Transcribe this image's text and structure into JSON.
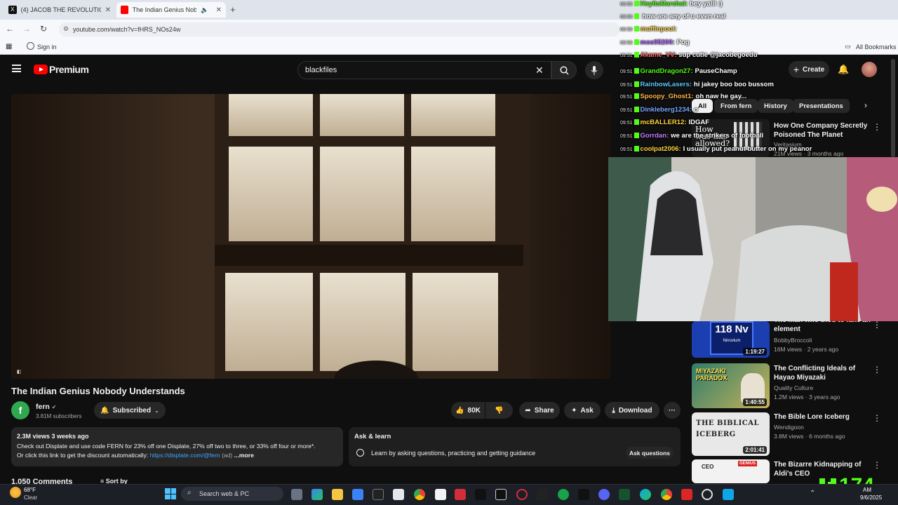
{
  "browser": {
    "tabs": [
      {
        "title": "(4) JACOB THE REVOLUTIONARY",
        "active": false
      },
      {
        "title": "The Indian Genius Nobody",
        "active": true
      }
    ],
    "url": "youtube.com/watch?v=fHRS_NOs24w",
    "sign_in": "Sign in",
    "all_bookmarks": "All Bookmarks"
  },
  "youtube": {
    "brand": "Premium",
    "search_value": "blackfiles",
    "create_label": "Create",
    "video_title": "The Indian Genius Nobody Understands",
    "channel_name": "fern",
    "subscribers": "3.81M subscribers",
    "subscribed_label": "Subscribed",
    "likes": "80K",
    "share_label": "Share",
    "ask_label": "Ask",
    "download_label": "Download",
    "description": {
      "meta": "2.3M views  3 weeks ago",
      "line1": "Check out Displate and use code FERN for 23% off one Displate, 27% off two to three, or 33% off four or more*.",
      "line2_prefix": "Or click this link to get the discount automatically:",
      "link": "https://displate.com/@fern",
      "line2_suffix": "(ad)",
      "more": "...more"
    },
    "ask_learn": {
      "title": "Ask & learn",
      "text": "Learn by asking questions, practicing and getting guidance",
      "button": "Ask questions"
    },
    "comments_partial": "1,050 Comments",
    "sort_by": "Sort by",
    "chips": [
      "All",
      "From fern",
      "History",
      "Presentations"
    ],
    "recommendations": [
      {
        "title": "How One Company Secretly Poisoned The Planet",
        "channel": "Veritasium",
        "meta": "21M views · 3 months ago",
        "thumb_text": "How was this allowed?"
      },
      {
        "title": "The man who tried to fake an element",
        "channel": "BobbyBroccoli",
        "meta": "16M views · 2 years ago",
        "duration": "1:19:27",
        "thumb_text": "118 Nv",
        "thumb_sub": "Ninovium"
      },
      {
        "title": "The Conflicting Ideals of Hayao Miyazaki",
        "channel": "Quality Culture",
        "meta": "1.2M views · 3 years ago",
        "duration": "1:40:55",
        "thumb_text": "MIYAZAKI PARADOX"
      },
      {
        "title": "The Bible Lore Iceberg",
        "channel": "Wendigoon",
        "meta": "3.8M views · 6 months ago",
        "duration": "2:01:41",
        "thumb_text": "THE BIBLICAL ICEBERG"
      },
      {
        "title": "The Bizarre Kidnapping of Aldi's CEO",
        "channel": "",
        "meta": "",
        "thumb_text": "CEO",
        "thumb_tag": "GENIUS"
      }
    ]
  },
  "chat": [
    {
      "time": "09:50",
      "user": "HeyItsMarshal:",
      "msg": "hey yalll :)",
      "color": "#53fc18"
    },
    {
      "time": "09:50",
      "user": "",
      "msg": "how are any of u even real",
      "color": "#53fc18"
    },
    {
      "time": "09:50",
      "user": "muffinpool:",
      "msg": "",
      "color": "#ffd23c"
    },
    {
      "time": "09:50",
      "user": "mos95200:",
      "msg": "Pog",
      "color": "#b36bff"
    },
    {
      "time": "09:51",
      "user": "Akame_VV:",
      "msg": "sup cutie @jacobegoedu",
      "color": "#ff6b6b"
    },
    {
      "time": "09:51",
      "user": "GrandDragon27:",
      "msg": "PauseChamp",
      "color": "#53fc18"
    },
    {
      "time": "09:51",
      "user": "RainbowLasers:",
      "msg": "hi jakey boo boo bussom",
      "color": "#5bc8ff"
    },
    {
      "time": "09:51",
      "user": "Spoopy_Ghost1:",
      "msg": "oh naw he gay...",
      "color": "#ffb347"
    },
    {
      "time": "09:51",
      "user": "Dinkleberg1234:",
      "msg": "o",
      "color": "#7aa7ff"
    },
    {
      "time": "09:51",
      "user": "mcBALLER12:",
      "msg": "IDGAF",
      "color": "#ffd23c"
    },
    {
      "time": "09:51",
      "user": "Gorrdan:",
      "msg": "we are the strikers of football",
      "color": "#c77dff"
    },
    {
      "time": "09:51",
      "user": "coolpat2006:",
      "msg": "I usually put peanut butter on my peanor",
      "color": "#ffd23c"
    }
  ],
  "kick_overlay": {
    "count": "174",
    "color": "#53fc18"
  },
  "taskbar": {
    "temp": "68°F",
    "weather": "Clear",
    "search": "Search web & PC",
    "time": "AM",
    "date": "9/6/2025"
  },
  "colors": {
    "kick_green": "#53fc18",
    "yt_red": "#ff0000"
  }
}
